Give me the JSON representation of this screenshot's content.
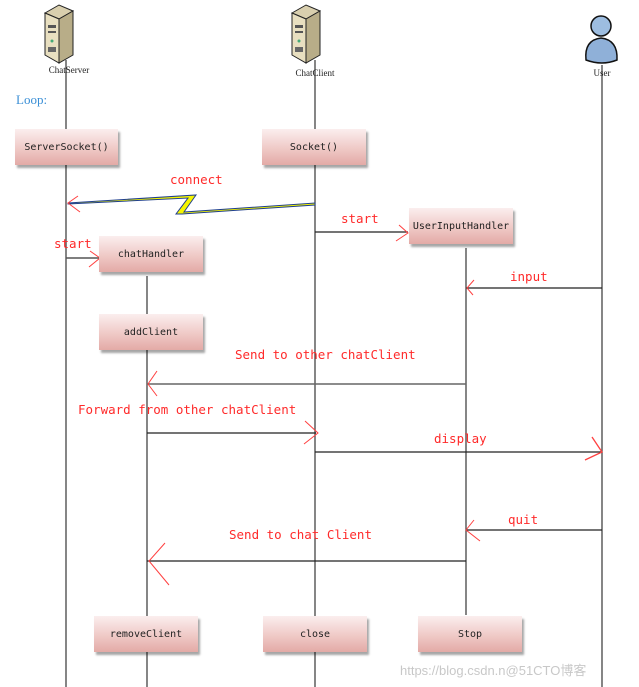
{
  "diagram": {
    "type": "sequence-diagram",
    "loop_label": "Loop:",
    "lifelines": [
      {
        "id": "server",
        "label": "ChatServer",
        "icon": "server-icon"
      },
      {
        "id": "client",
        "label": "ChatClient",
        "icon": "server-icon"
      },
      {
        "id": "user",
        "label": "User",
        "icon": "user-icon"
      }
    ],
    "activations": [
      {
        "id": "serversocket",
        "label": "ServerSocket()"
      },
      {
        "id": "socket",
        "label": "Socket()"
      },
      {
        "id": "chathandler",
        "label": "chatHandler"
      },
      {
        "id": "userinputhandler",
        "label": "UserInputHandler"
      },
      {
        "id": "addclient",
        "label": "addClient"
      },
      {
        "id": "removeclient",
        "label": "removeClient"
      },
      {
        "id": "close",
        "label": "close"
      },
      {
        "id": "stop",
        "label": "Stop"
      }
    ],
    "messages": [
      {
        "id": "connect",
        "label": "connect",
        "from": "ChatClient",
        "to": "ChatServer",
        "style": "lightning"
      },
      {
        "id": "start-server",
        "label": "start",
        "from": "ChatServer",
        "to": "chatHandler"
      },
      {
        "id": "start-client",
        "label": "start",
        "from": "ChatClient",
        "to": "UserInputHandler"
      },
      {
        "id": "input",
        "label": "input",
        "from": "User",
        "to": "UserInputHandler"
      },
      {
        "id": "send-other",
        "label": "Send to other chatClient",
        "from": "UserInputHandler",
        "to": "chatHandler"
      },
      {
        "id": "forward",
        "label": "Forward from other chatClient",
        "from": "chatHandler",
        "to": "ChatClient"
      },
      {
        "id": "display",
        "label": "display",
        "from": "ChatClient",
        "to": "User"
      },
      {
        "id": "quit",
        "label": "quit",
        "from": "User",
        "to": "UserInputHandler"
      },
      {
        "id": "send-chat",
        "label": "Send to chat Client",
        "from": "UserInputHandler",
        "to": "chatHandler"
      }
    ],
    "colors": {
      "message_text": "#ff2a2a",
      "loop_text": "#3a8fd6",
      "lightning_fill": "#f5f500",
      "lightning_stroke": "#1f3f8f"
    }
  },
  "watermark": "https://blog.csdn.n@51CTO博客"
}
